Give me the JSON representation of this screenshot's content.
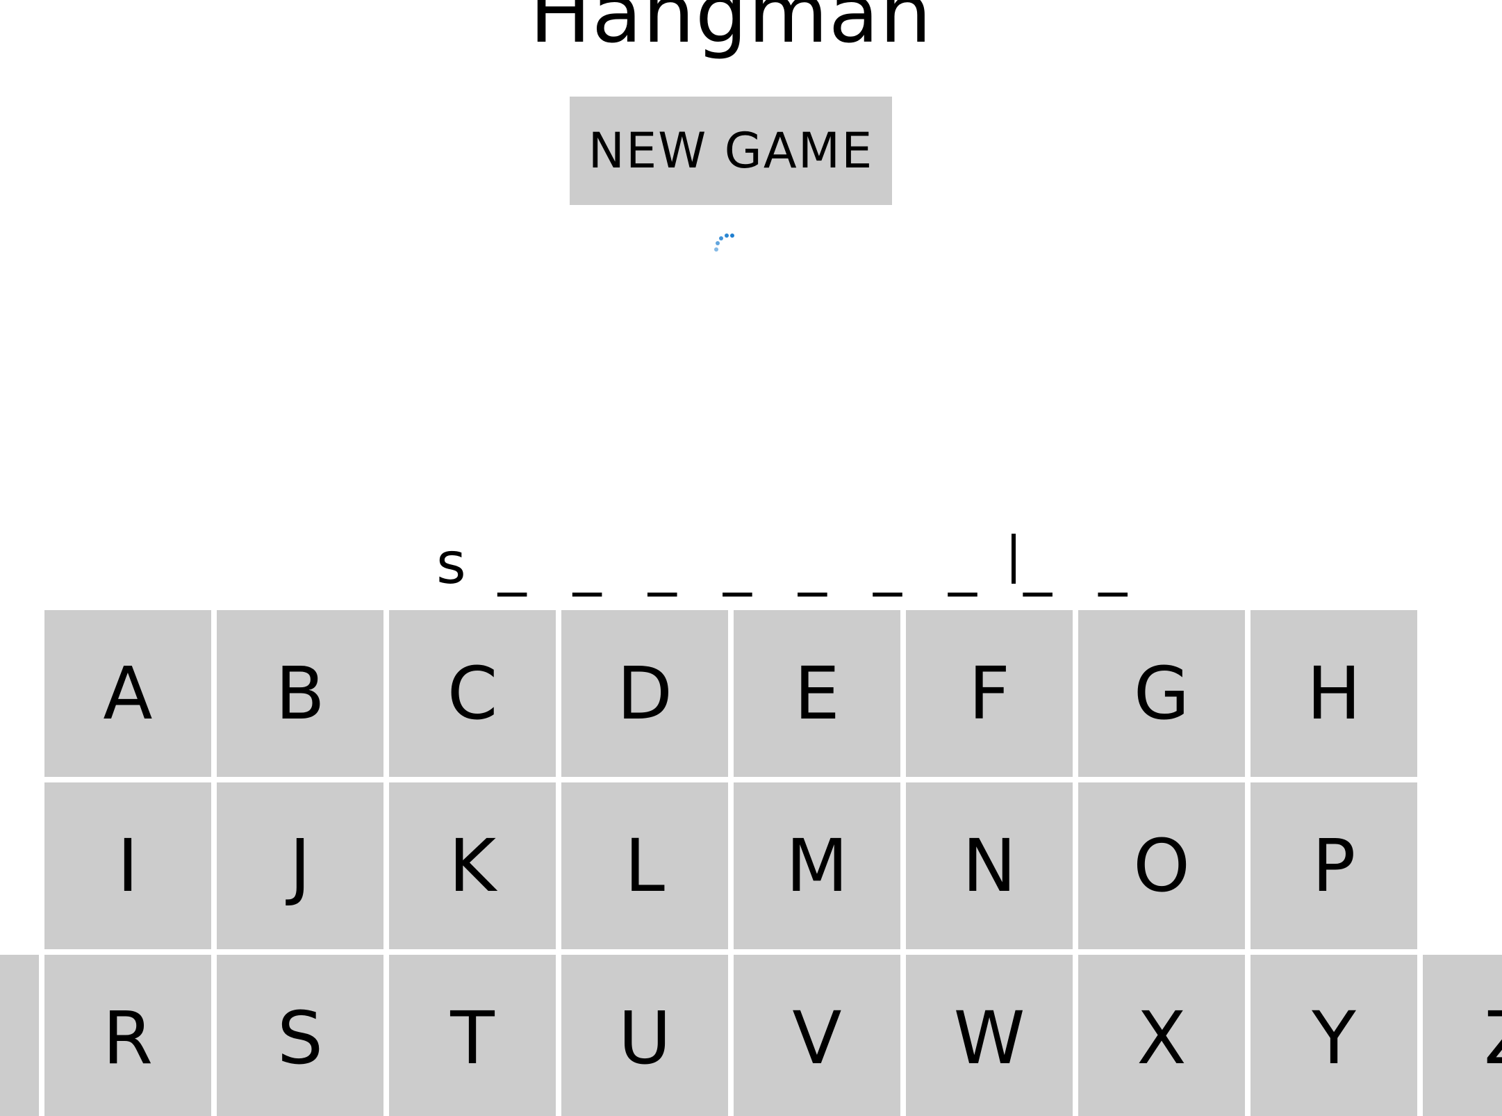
{
  "title": "Hangman",
  "new_game_label": "NEW GAME",
  "word": {
    "first_letter": "s",
    "blanks": [
      "_",
      "_",
      "_",
      "_",
      "_",
      "_",
      "_",
      "_",
      "_"
    ]
  },
  "keyboard": {
    "row1": [
      "A",
      "B",
      "C",
      "D",
      "E",
      "F",
      "G",
      "H"
    ],
    "row2": [
      "I",
      "J",
      "K",
      "L",
      "M",
      "N",
      "O",
      "P"
    ],
    "row3": [
      "R",
      "S",
      "T",
      "U",
      "V",
      "W",
      "X",
      "Y",
      "Z"
    ]
  },
  "colors": {
    "key_background": "#cccccc",
    "spinner": "#1f7fd0"
  }
}
